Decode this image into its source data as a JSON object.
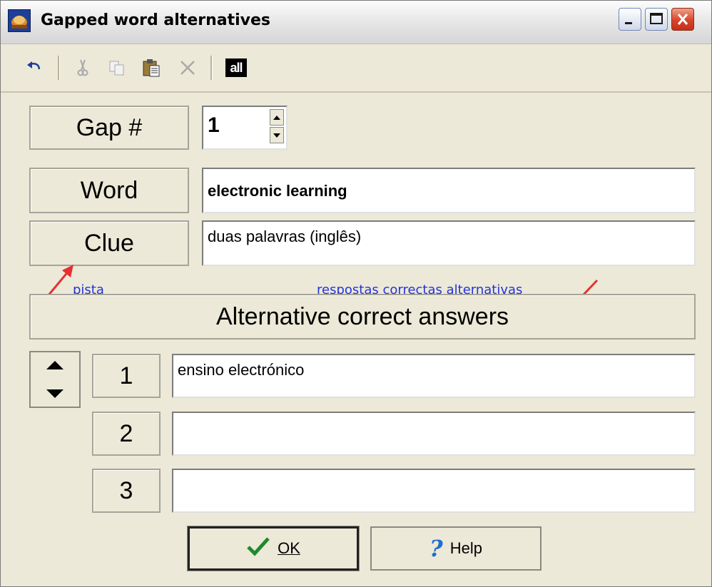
{
  "window": {
    "title": "Gapped word alternatives",
    "controls": [
      "minimize-icon",
      "maximize-icon",
      "close-icon"
    ]
  },
  "toolbar": {
    "tools": [
      "undo-icon",
      "cut-icon",
      "copy-icon",
      "paste-icon",
      "delete-icon"
    ],
    "all_label": "all"
  },
  "gap": {
    "label": "Gap #",
    "value": "1"
  },
  "word": {
    "label": "Word",
    "value": "electronic learning"
  },
  "clue": {
    "label": "Clue",
    "value": "duas palavras (inglês)"
  },
  "annotations": {
    "pista": "pista",
    "alternatives": "respostas correctas alternativas",
    "arrow_color": "#e53030",
    "text_color": "#2233dd"
  },
  "alternatives": {
    "header": "Alternative correct answers",
    "rows": [
      {
        "number": "1",
        "value": "ensino electrónico"
      },
      {
        "number": "2",
        "value": ""
      },
      {
        "number": "3",
        "value": ""
      }
    ]
  },
  "buttons": {
    "ok_label": "OK",
    "help_label": "Help"
  }
}
